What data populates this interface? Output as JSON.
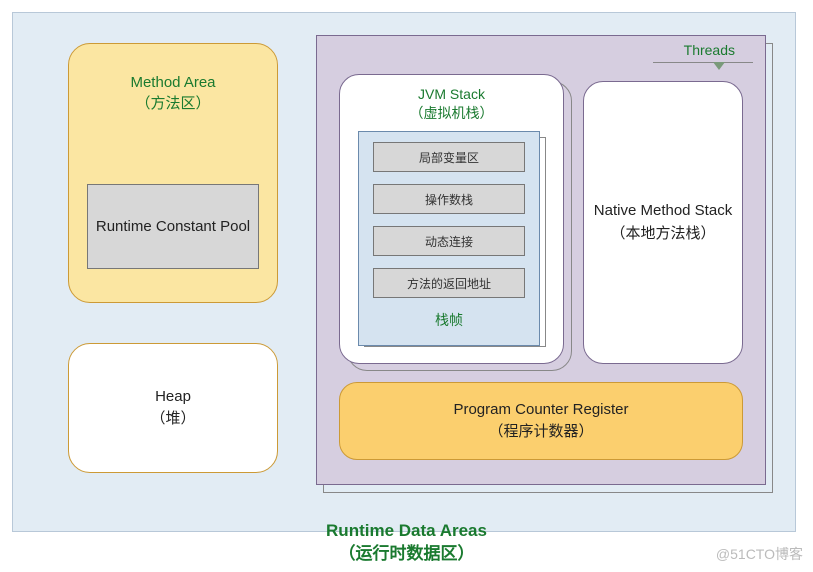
{
  "diagram": {
    "title_en": "Runtime Data Areas",
    "title_zh": "（运行时数据区）",
    "method_area": {
      "title_en": "Method Area",
      "title_zh": "（方法区）",
      "runtime_constant_pool": "Runtime Constant Pool"
    },
    "heap": {
      "title_en": "Heap",
      "title_zh": "（堆）"
    },
    "threads": {
      "label": "Threads",
      "jvm_stack": {
        "title_en": "JVM Stack",
        "title_zh": "（虚拟机栈）",
        "frame_label": "栈帧",
        "frame_items": [
          "局部变量区",
          "操作数栈",
          "动态连接",
          "方法的返回地址"
        ]
      },
      "native_stack": {
        "title_en": "Native Method Stack",
        "title_zh": "（本地方法栈）"
      },
      "pcr": {
        "title_en": "Program Counter Register",
        "title_zh": "（程序计数器）"
      }
    }
  },
  "watermark": "@51CTO博客"
}
